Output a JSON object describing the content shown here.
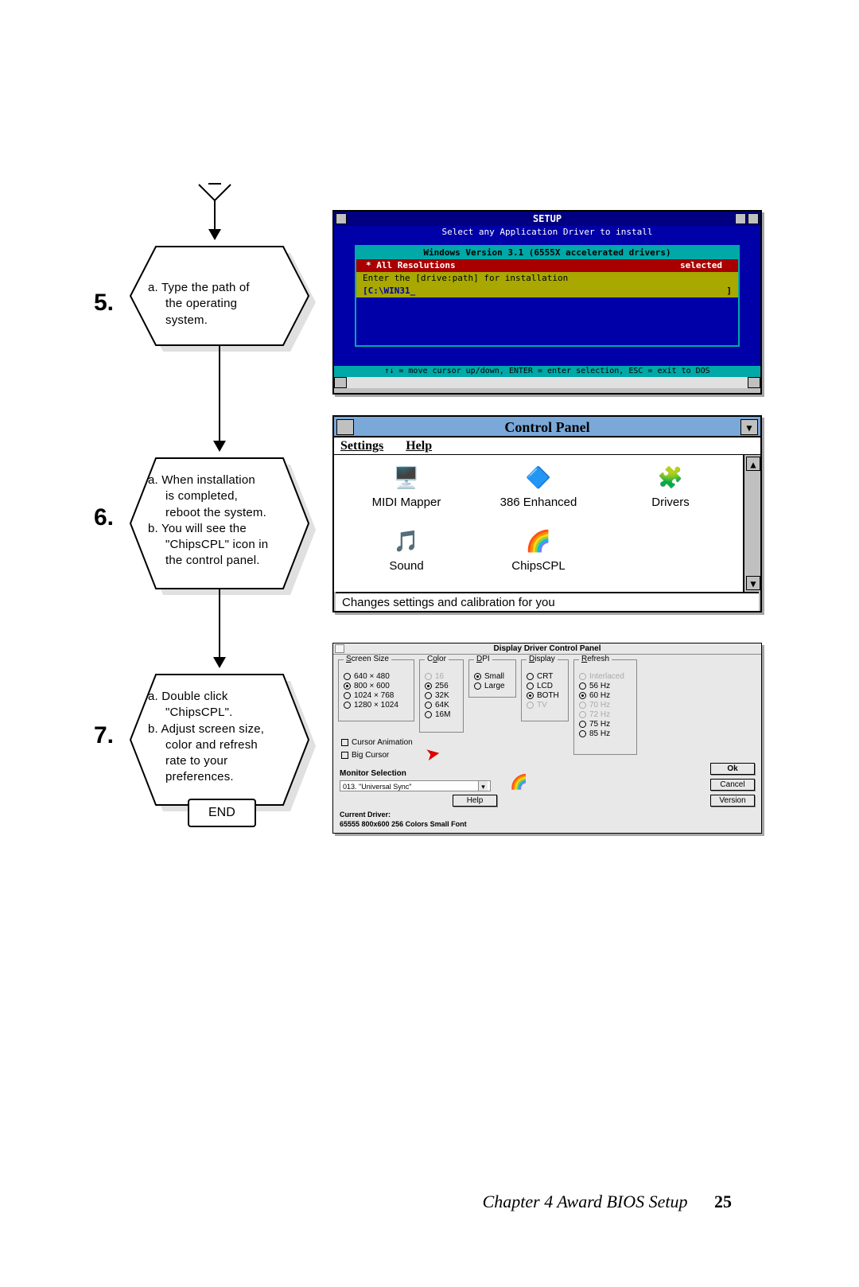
{
  "flow": {
    "start_stub": "",
    "steps": [
      {
        "num": "5.",
        "lines": [
          "a.  Type the path of",
          "the operating",
          "system."
        ]
      },
      {
        "num": "6.",
        "lines": [
          "a.  When installation",
          "is completed,",
          "reboot the system.",
          "b.  You will see the",
          "\"ChipsCPL\" icon in",
          "the control panel."
        ]
      },
      {
        "num": "7.",
        "lines": [
          "a.  Double click",
          "\"ChipsCPL\".",
          "b.  Adjust screen size,",
          "color and refresh",
          "rate to your",
          "preferences."
        ]
      }
    ],
    "end": "END"
  },
  "shot1": {
    "title": "SETUP",
    "subtitle": "Select any Application Driver to install",
    "panel_title": "Windows Version 3.1 (6555X accelerated drivers)",
    "row_left": "All Resolutions",
    "row_right": "selected",
    "prompt": "Enter the [drive:path] for installation",
    "path": "[C:\\WIN31_",
    "footer": "↑↓ = move cursor up/down, ENTER = enter selection, ESC = exit to DOS"
  },
  "shot2": {
    "title": "Control Panel",
    "menu": [
      "Settings",
      "Help"
    ],
    "icons": [
      {
        "label": "MIDI Mapper",
        "glyph": "🖥️"
      },
      {
        "label": "386 Enhanced",
        "glyph": "🔷"
      },
      {
        "label": "Drivers",
        "glyph": "🧩"
      },
      {
        "label": "Sound",
        "glyph": "🎵"
      },
      {
        "label": "ChipsCPL",
        "glyph": "🌈"
      },
      {
        "label": "",
        "glyph": ""
      }
    ],
    "status": "Changes settings and calibration for you"
  },
  "shot3": {
    "title": "Display Driver Control Panel",
    "screen_size": {
      "legend": "Screen Size",
      "options": [
        "640 × 480",
        "800 × 600",
        "1024 × 768",
        "1280 × 1024"
      ],
      "selected": "800 × 600"
    },
    "color": {
      "legend": "Color",
      "options": [
        "16",
        "256",
        "32K",
        "64K",
        "16M"
      ],
      "selected": "256",
      "disabled": [
        "16"
      ]
    },
    "dpi": {
      "legend": "DPI",
      "options": [
        "Small",
        "Large"
      ],
      "selected": "Small"
    },
    "display": {
      "legend": "Display",
      "options": [
        "CRT",
        "LCD",
        "BOTH",
        "TV"
      ],
      "selected": "BOTH",
      "disabled": [
        "TV"
      ]
    },
    "refresh": {
      "legend": "Refresh",
      "options": [
        "Interlaced",
        "56 Hz",
        "60 Hz",
        "70 Hz",
        "72 Hz",
        "75 Hz",
        "85 Hz"
      ],
      "selected": "60 Hz",
      "disabled": [
        "Interlaced",
        "70 Hz",
        "72 Hz"
      ]
    },
    "cursor_anim": "Cursor Animation",
    "big_cursor": "Big Cursor",
    "monitor_label": "Monitor Selection",
    "monitor_value": "013. \"Universal Sync\"",
    "buttons": [
      "Ok",
      "Cancel",
      "Version"
    ],
    "help_btn": "Help",
    "current_label": "Current Driver:",
    "current_value": "65555 800x600 256 Colors Small Font"
  },
  "footer": {
    "chapter": "Chapter 4  Award BIOS Setup",
    "page": "25"
  }
}
